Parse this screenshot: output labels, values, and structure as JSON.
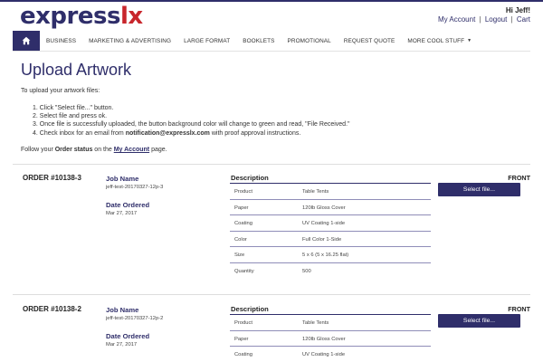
{
  "brand": {
    "logo_part1": "express",
    "logo_part2": "lx"
  },
  "user": {
    "greeting": "Hi Jeff!",
    "links": [
      "My Account",
      "Logout",
      "Cart"
    ],
    "separator": "|"
  },
  "nav": {
    "home_icon": "home-icon",
    "items": [
      "BUSINESS",
      "MARKETING & ADVERTISING",
      "LARGE FORMAT",
      "BOOKLETS",
      "PROMOTIONAL",
      "REQUEST QUOTE",
      "MORE COOL STUFF"
    ],
    "more_caret": "▼"
  },
  "page": {
    "title": "Upload Artwork",
    "intro": "To upload your artwork files:",
    "steps": [
      "1. Click \"Select file...\" button.",
      "2. Select file and press ok.",
      "3. Once file is successfully uploaded, the button background color will change to green and read, \"File Received.\""
    ],
    "step4_prefix": "4. Check inbox for an email from ",
    "step4_email": "notification@expresslx.com",
    "step4_suffix": " with proof approval instructions.",
    "follow_prefix": "Follow your ",
    "follow_bold": "Order status",
    "follow_mid": " on the ",
    "follow_link": "My Account",
    "follow_suffix": " page."
  },
  "labels": {
    "job_name": "Job Name",
    "date_ordered": "Date Ordered",
    "description": "Description",
    "front": "FRONT",
    "select_file": "Select file..."
  },
  "orders": [
    {
      "number": "ORDER #10138-3",
      "job_name": "jeff-test-20170327-12p-3",
      "date": "Mar 27, 2017",
      "description": [
        {
          "k": "Product",
          "v": "Table Tents"
        },
        {
          "k": "Paper",
          "v": "120lb Gloss Cover"
        },
        {
          "k": "Coating",
          "v": "UV Coating 1-side"
        },
        {
          "k": "Color",
          "v": "Full Color 1-Side"
        },
        {
          "k": "Size",
          "v": "5 x 6 (5 x 16.25 flat)"
        },
        {
          "k": "Quantity",
          "v": "500"
        }
      ]
    },
    {
      "number": "ORDER #10138-2",
      "job_name": "jeff-test-20170327-12p-2",
      "date": "Mar 27, 2017",
      "description": [
        {
          "k": "Product",
          "v": "Table Tents"
        },
        {
          "k": "Paper",
          "v": "120lb Gloss Cover"
        },
        {
          "k": "Coating",
          "v": "UV Coating 1-side"
        }
      ]
    }
  ],
  "colors": {
    "brand_navy": "#2f2e6a",
    "brand_red": "#c8262c"
  }
}
